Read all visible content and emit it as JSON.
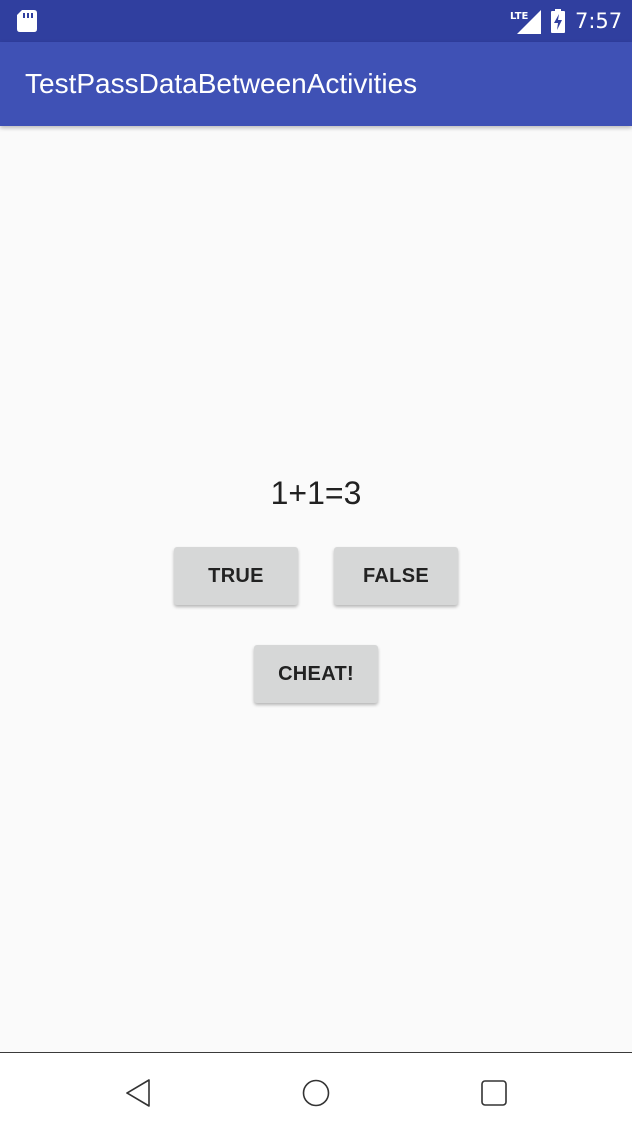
{
  "status_bar": {
    "time": "7:57",
    "network_label": "LTE",
    "icons": [
      "sd-card-icon",
      "lte-signal-icon",
      "battery-charging-icon"
    ]
  },
  "app_bar": {
    "title": "TestPassDataBetweenActivities",
    "color": "#3f51b5",
    "status_color": "#303f9f"
  },
  "main": {
    "question": "1+1=3",
    "true_label": "TRUE",
    "false_label": "FALSE",
    "cheat_label": "CHEAT!"
  },
  "nav_bar": {
    "icons": [
      "back-icon",
      "home-icon",
      "recents-icon"
    ]
  }
}
